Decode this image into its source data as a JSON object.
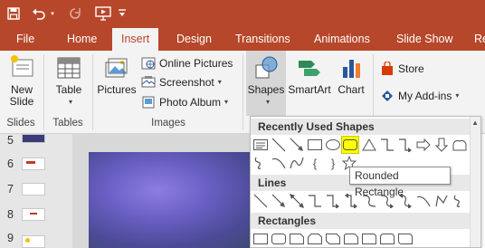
{
  "colors": {
    "accent": "#b7472a",
    "ribbon_bg": "#f3f3f3",
    "highlight": "#ffff00"
  },
  "quick_access": {
    "save_icon": "save-icon",
    "undo_icon": "undo-icon",
    "redo_icon": "redo-icon",
    "present_icon": "present-from-start-icon",
    "customize_icon": "customize-qat-icon"
  },
  "tabs": [
    "File",
    "Home",
    "Insert",
    "Design",
    "Transitions",
    "Animations",
    "Slide Show",
    "Re"
  ],
  "active_tab": "Insert",
  "ribbon": {
    "slides": {
      "new_slide_line1": "New",
      "new_slide_line2": "Slide",
      "group": "Slides"
    },
    "tables": {
      "table": "Table",
      "group": "Tables"
    },
    "images": {
      "pictures": "Pictures",
      "online_pictures": "Online Pictures",
      "screenshot": "Screenshot",
      "photo_album": "Photo Album",
      "group": "Images"
    },
    "illustrations": {
      "shapes": "Shapes",
      "smartart": "SmartArt",
      "chart": "Chart"
    },
    "addins": {
      "store": "Store",
      "my_addins": "My Add-ins"
    }
  },
  "slide_panel": {
    "numbers": [
      "5",
      "6",
      "7",
      "8",
      "9"
    ]
  },
  "shapes_gallery": {
    "recently_used": "Recently Used Shapes",
    "lines": "Lines",
    "rectangles": "Rectangles",
    "tooltip": "Rounded Rectangle",
    "icons_row1": [
      "text-box-icon",
      "line-icon",
      "arrow-line-icon",
      "rectangle-icon",
      "oval-icon",
      "rounded-rectangle-icon",
      "triangle-icon",
      "elbow-connector-icon",
      "elbow-arrow-connector-icon",
      "right-arrow-icon",
      "down-arrow-icon",
      "flowchart-icon"
    ],
    "icons_row2": [
      "freeform-icon",
      "curve-icon",
      "arc-icon",
      "left-brace-icon",
      "right-brace-icon",
      "star-icon"
    ],
    "brace_left": "{",
    "brace_right": "}"
  }
}
